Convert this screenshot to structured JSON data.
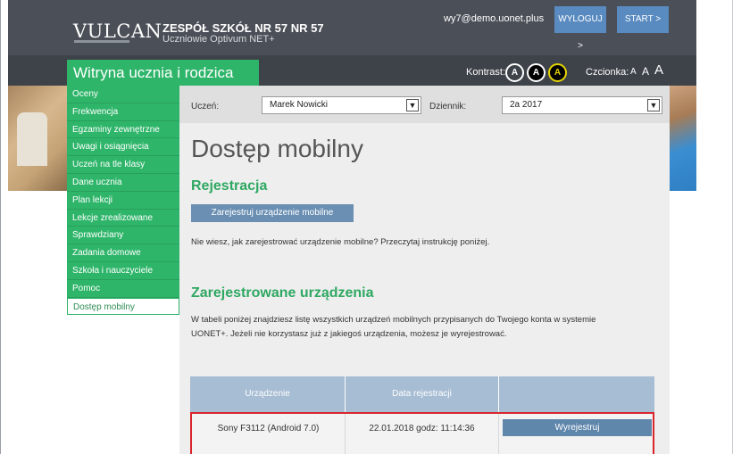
{
  "header": {
    "logo": "VULCAN",
    "school_name": "ZESPÓŁ SZKÓŁ NR 57 NR 57",
    "school_subtitle": "Uczniowie Optivum NET+",
    "user_email": "wy7@demo.uonet.plus",
    "logout_label": "WYLOGUJ >",
    "start_label": "START >"
  },
  "band": {
    "title": "Witryna ucznia i rodzica",
    "contrast_label": "Kontrast:",
    "contrast_options": [
      "A",
      "A",
      "A"
    ],
    "font_label": "Czcionka:",
    "font_options": [
      "A",
      "A",
      "A"
    ]
  },
  "menu": [
    "Oceny",
    "Frekwencja",
    "Egzaminy zewnętrzne",
    "Uwagi i osiągnięcia",
    "Uczeń na tle klasy",
    "Dane ucznia",
    "Plan lekcji",
    "Lekcje zrealizowane",
    "Sprawdziany",
    "Zadania domowe",
    "Szkoła i nauczyciele",
    "Pomoc",
    "Dostęp mobilny"
  ],
  "selectors": {
    "student_label": "Uczeń:",
    "student_value": "Marek Nowicki",
    "journal_label": "Dziennik:",
    "journal_value": "2a 2017"
  },
  "main": {
    "title": "Dostęp mobilny",
    "registration_heading": "Rejestracja",
    "register_button": "Zarejestruj urządzenie mobilne",
    "registration_hint": "Nie wiesz, jak zarejestrować urządzenie mobilne? Przeczytaj instrukcję poniżej.",
    "devices_heading": "Zarejestrowane urządzenia",
    "devices_text_1": "W tabeli poniżej znajdziesz listę wszystkich urządzeń mobilnych przypisanych do Twojego konta w systemie",
    "devices_text_2": "UONET+. Jeżeli nie korzystasz już z jakiegoś urządzenia, możesz je wyrejestrować."
  },
  "table": {
    "headers": [
      "Urządzenie",
      "Data rejestracji",
      ""
    ],
    "rows": [
      {
        "device": "Sony F3112 (Android 7.0)",
        "date": "22.01.2018 godz: 11:14:36",
        "action": "Wyrejestruj"
      }
    ]
  },
  "colors": {
    "green": "#2fb56a",
    "header_dark": "#4b4f57",
    "button_blue": "#5a8bc0",
    "highlight_red": "#d9262c"
  }
}
